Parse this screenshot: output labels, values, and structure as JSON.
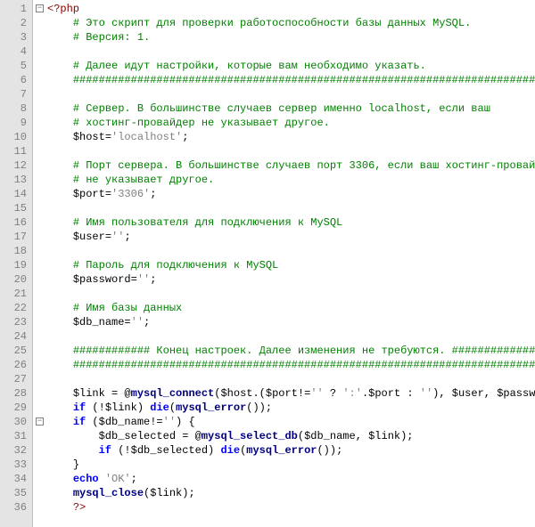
{
  "lines": [
    {
      "n": 1,
      "fold": true,
      "indent": 0,
      "segs": [
        {
          "t": "<?php",
          "c": "c-red"
        }
      ]
    },
    {
      "n": 2,
      "fold": false,
      "indent": 1,
      "segs": [
        {
          "t": "# Это скрипт для проверки работоспособности базы данных MySQL.",
          "c": "c-green"
        }
      ]
    },
    {
      "n": 3,
      "fold": false,
      "indent": 1,
      "segs": [
        {
          "t": "# Версия: 1.",
          "c": "c-green"
        }
      ]
    },
    {
      "n": 4,
      "fold": false,
      "indent": 0,
      "segs": []
    },
    {
      "n": 5,
      "fold": false,
      "indent": 1,
      "segs": [
        {
          "t": "# Далее идут настройки, которые вам необходимо указать.",
          "c": "c-green"
        }
      ]
    },
    {
      "n": 6,
      "fold": false,
      "indent": 1,
      "segs": [
        {
          "t": "########################################################################",
          "c": "c-green"
        }
      ]
    },
    {
      "n": 7,
      "fold": false,
      "indent": 0,
      "segs": []
    },
    {
      "n": 8,
      "fold": false,
      "indent": 1,
      "segs": [
        {
          "t": "# Сервер. В большинстве случаев сервер именно localhost, если ваш",
          "c": "c-green"
        }
      ]
    },
    {
      "n": 9,
      "fold": false,
      "indent": 1,
      "segs": [
        {
          "t": "# хостинг-провайдер не указывает другое.",
          "c": "c-green"
        }
      ]
    },
    {
      "n": 10,
      "fold": false,
      "indent": 1,
      "segs": [
        {
          "t": "$host",
          "c": "c-black"
        },
        {
          "t": "=",
          "c": "c-black"
        },
        {
          "t": "'localhost'",
          "c": "c-gray"
        },
        {
          "t": ";",
          "c": "c-black"
        }
      ]
    },
    {
      "n": 11,
      "fold": false,
      "indent": 0,
      "segs": []
    },
    {
      "n": 12,
      "fold": false,
      "indent": 1,
      "segs": [
        {
          "t": "# Порт сервера. В большинстве случаев порт 3306, если ваш хостинг-провайдер",
          "c": "c-green"
        }
      ]
    },
    {
      "n": 13,
      "fold": false,
      "indent": 1,
      "segs": [
        {
          "t": "# не указывает другое.",
          "c": "c-green"
        }
      ]
    },
    {
      "n": 14,
      "fold": false,
      "indent": 1,
      "segs": [
        {
          "t": "$port",
          "c": "c-black"
        },
        {
          "t": "=",
          "c": "c-black"
        },
        {
          "t": "'3306'",
          "c": "c-gray"
        },
        {
          "t": ";",
          "c": "c-black"
        }
      ]
    },
    {
      "n": 15,
      "fold": false,
      "indent": 0,
      "segs": []
    },
    {
      "n": 16,
      "fold": false,
      "indent": 1,
      "segs": [
        {
          "t": "# Имя пользователя для подключения к MySQL",
          "c": "c-green"
        }
      ]
    },
    {
      "n": 17,
      "fold": false,
      "indent": 1,
      "segs": [
        {
          "t": "$user",
          "c": "c-black"
        },
        {
          "t": "=",
          "c": "c-black"
        },
        {
          "t": "''",
          "c": "c-gray"
        },
        {
          "t": ";",
          "c": "c-black"
        }
      ]
    },
    {
      "n": 18,
      "fold": false,
      "indent": 0,
      "segs": []
    },
    {
      "n": 19,
      "fold": false,
      "indent": 1,
      "segs": [
        {
          "t": "# Пароль для подключения к MySQL",
          "c": "c-green"
        }
      ]
    },
    {
      "n": 20,
      "fold": false,
      "indent": 1,
      "segs": [
        {
          "t": "$password",
          "c": "c-black"
        },
        {
          "t": "=",
          "c": "c-black"
        },
        {
          "t": "''",
          "c": "c-gray"
        },
        {
          "t": ";",
          "c": "c-black"
        }
      ]
    },
    {
      "n": 21,
      "fold": false,
      "indent": 0,
      "segs": []
    },
    {
      "n": 22,
      "fold": false,
      "indent": 1,
      "segs": [
        {
          "t": "# Имя базы данных",
          "c": "c-green"
        }
      ]
    },
    {
      "n": 23,
      "fold": false,
      "indent": 1,
      "segs": [
        {
          "t": "$db_name",
          "c": "c-black"
        },
        {
          "t": "=",
          "c": "c-black"
        },
        {
          "t": "''",
          "c": "c-gray"
        },
        {
          "t": ";",
          "c": "c-black"
        }
      ]
    },
    {
      "n": 24,
      "fold": false,
      "indent": 0,
      "segs": []
    },
    {
      "n": 25,
      "fold": false,
      "indent": 1,
      "segs": [
        {
          "t": "############ Конец настроек. Далее изменения не требуются. #############",
          "c": "c-green"
        }
      ]
    },
    {
      "n": 26,
      "fold": false,
      "indent": 1,
      "segs": [
        {
          "t": "########################################################################",
          "c": "c-green"
        }
      ]
    },
    {
      "n": 27,
      "fold": false,
      "indent": 0,
      "segs": []
    },
    {
      "n": 28,
      "fold": false,
      "indent": 1,
      "segs": [
        {
          "t": "$link ",
          "c": "c-black"
        },
        {
          "t": "= @",
          "c": "c-black"
        },
        {
          "t": "mysql_connect",
          "c": "c-word"
        },
        {
          "t": "(",
          "c": "c-black"
        },
        {
          "t": "$host",
          "c": "c-black"
        },
        {
          "t": ".(",
          "c": "c-black"
        },
        {
          "t": "$port",
          "c": "c-black"
        },
        {
          "t": "!=",
          "c": "c-black"
        },
        {
          "t": "''",
          "c": "c-gray"
        },
        {
          "t": " ? ",
          "c": "c-black"
        },
        {
          "t": "':'",
          "c": "c-gray"
        },
        {
          "t": ".",
          "c": "c-black"
        },
        {
          "t": "$port",
          "c": "c-black"
        },
        {
          "t": " : ",
          "c": "c-black"
        },
        {
          "t": "''",
          "c": "c-gray"
        },
        {
          "t": "), ",
          "c": "c-black"
        },
        {
          "t": "$user",
          "c": "c-black"
        },
        {
          "t": ", ",
          "c": "c-black"
        },
        {
          "t": "$password",
          "c": "c-black"
        },
        {
          "t": ");",
          "c": "c-black"
        }
      ]
    },
    {
      "n": 29,
      "fold": false,
      "indent": 1,
      "segs": [
        {
          "t": "if",
          "c": "c-blue b"
        },
        {
          "t": " (!",
          "c": "c-black"
        },
        {
          "t": "$link",
          "c": "c-black"
        },
        {
          "t": ") ",
          "c": "c-black"
        },
        {
          "t": "die",
          "c": "c-blue b"
        },
        {
          "t": "(",
          "c": "c-black"
        },
        {
          "t": "mysql_error",
          "c": "c-word"
        },
        {
          "t": "());",
          "c": "c-black"
        }
      ]
    },
    {
      "n": 30,
      "fold": true,
      "indent": 1,
      "segs": [
        {
          "t": "if",
          "c": "c-blue b"
        },
        {
          "t": " (",
          "c": "c-black"
        },
        {
          "t": "$db_name",
          "c": "c-black"
        },
        {
          "t": "!=",
          "c": "c-black"
        },
        {
          "t": "''",
          "c": "c-gray"
        },
        {
          "t": ") {",
          "c": "c-black"
        }
      ]
    },
    {
      "n": 31,
      "fold": false,
      "indent": 2,
      "segs": [
        {
          "t": "$db_selected ",
          "c": "c-black"
        },
        {
          "t": "= @",
          "c": "c-black"
        },
        {
          "t": "mysql_select_db",
          "c": "c-word"
        },
        {
          "t": "(",
          "c": "c-black"
        },
        {
          "t": "$db_name",
          "c": "c-black"
        },
        {
          "t": ", ",
          "c": "c-black"
        },
        {
          "t": "$link",
          "c": "c-black"
        },
        {
          "t": ");",
          "c": "c-black"
        }
      ]
    },
    {
      "n": 32,
      "fold": false,
      "indent": 2,
      "segs": [
        {
          "t": "if",
          "c": "c-blue b"
        },
        {
          "t": " (!",
          "c": "c-black"
        },
        {
          "t": "$db_selected",
          "c": "c-black"
        },
        {
          "t": ") ",
          "c": "c-black"
        },
        {
          "t": "die",
          "c": "c-blue b"
        },
        {
          "t": "(",
          "c": "c-black"
        },
        {
          "t": "mysql_error",
          "c": "c-word"
        },
        {
          "t": "());",
          "c": "c-black"
        }
      ]
    },
    {
      "n": 33,
      "fold": false,
      "indent": 1,
      "segs": [
        {
          "t": "}",
          "c": "c-black"
        }
      ]
    },
    {
      "n": 34,
      "fold": false,
      "indent": 1,
      "segs": [
        {
          "t": "echo",
          "c": "c-blue b"
        },
        {
          "t": " ",
          "c": "c-black"
        },
        {
          "t": "'OK'",
          "c": "c-gray"
        },
        {
          "t": ";",
          "c": "c-black"
        }
      ]
    },
    {
      "n": 35,
      "fold": false,
      "indent": 1,
      "segs": [
        {
          "t": "mysql_close",
          "c": "c-word"
        },
        {
          "t": "(",
          "c": "c-black"
        },
        {
          "t": "$link",
          "c": "c-black"
        },
        {
          "t": ");",
          "c": "c-black"
        }
      ]
    },
    {
      "n": 36,
      "fold": false,
      "indent": 1,
      "segs": [
        {
          "t": "?>",
          "c": "c-red"
        }
      ]
    }
  ],
  "indent_unit": "    "
}
